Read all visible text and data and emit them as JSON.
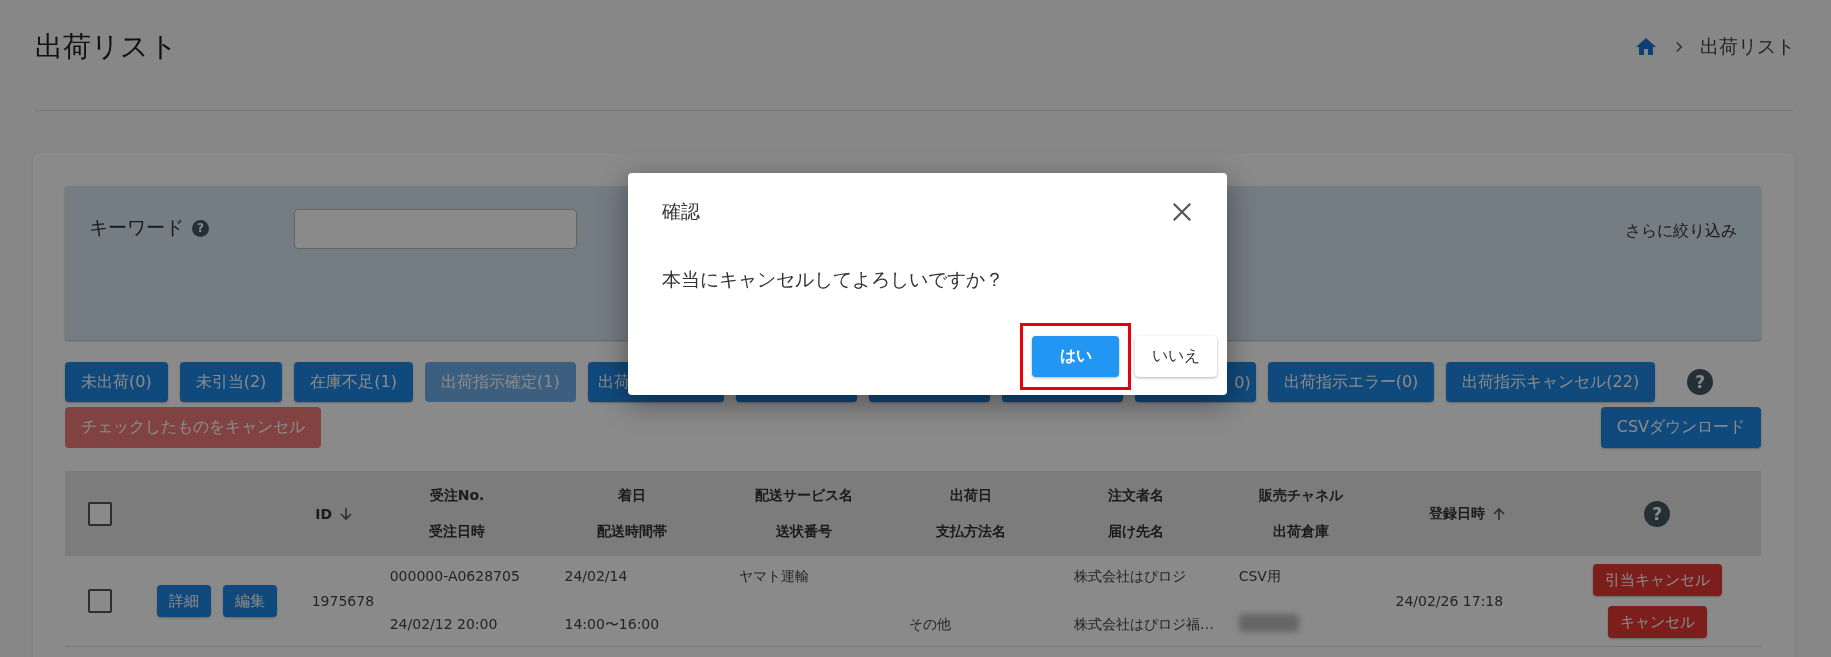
{
  "page": {
    "title": "出荷リスト"
  },
  "breadcrumb": {
    "current": "出荷リスト"
  },
  "filter": {
    "keyword_label": "キーワード",
    "help_icon": "?",
    "more_filters": "さらに絞り込み"
  },
  "status_help_icon": "?",
  "status_buttons": [
    {
      "label": "未出荷(0)",
      "disabled": false,
      "covered": false
    },
    {
      "label": "未引当(2)",
      "disabled": false,
      "covered": false
    },
    {
      "label": "在庫不足(1)",
      "disabled": false,
      "covered": false
    },
    {
      "label": "出荷指示確定(1)",
      "disabled": true,
      "covered": false
    },
    {
      "label": "出荷",
      "disabled": false,
      "covered": true,
      "shows_end": false
    },
    {
      "disabled": false,
      "covered": true
    },
    {
      "disabled": false,
      "covered": true
    },
    {
      "disabled": false,
      "covered": true
    },
    {
      "label": "0)",
      "disabled": false,
      "covered": true,
      "shows_end": true
    },
    {
      "label": "出荷指示エラー(0)",
      "disabled": false,
      "covered": false
    },
    {
      "label": "出荷指示キャンセル(22)",
      "disabled": false,
      "covered": false
    }
  ],
  "bulk_cancel": {
    "label": "チェックしたものをキャンセル",
    "disabled": true
  },
  "csv_button": {
    "label": "CSVダウンロード"
  },
  "table": {
    "columns": [
      {
        "kind": "checkbox",
        "checked": false
      },
      {
        "kind": "blank"
      },
      {
        "kind": "single",
        "label": "ID",
        "sort_descending": true
      },
      {
        "kind": "double",
        "top": "受注No.",
        "bottom": "受注日時"
      },
      {
        "kind": "double",
        "top": "着日",
        "bottom": "配送時間帯"
      },
      {
        "kind": "double",
        "top": "配送サービス名",
        "bottom": "送状番号"
      },
      {
        "kind": "double",
        "top": "出荷日",
        "bottom": "支払方法名"
      },
      {
        "kind": "double",
        "top": "注文者名",
        "bottom": "届け先名"
      },
      {
        "kind": "double",
        "top": "販売チャネル",
        "bottom": "出荷倉庫"
      },
      {
        "kind": "single",
        "label": "登録日時",
        "sort_descending": false
      },
      {
        "kind": "help",
        "label": "?"
      }
    ],
    "rows": [
      {
        "checked": false,
        "actions": [
          "詳細",
          "編集"
        ],
        "id": "1975678",
        "order_no": "000000-A0628705",
        "order_date": "24/02/12 20:00",
        "arrival_date": "24/02/14",
        "time_slot": "14:00〜16:00",
        "service": "ヤマト運輸",
        "payment": "その他",
        "orderer": "株式会社はぴロジ",
        "recipient": "株式会社はぴロジ福…",
        "channel": "CSV用",
        "warehouse_blurred": true,
        "registered": "24/02/26 17:18",
        "cancel_buttons": [
          "引当キャンセル",
          "キャンセル"
        ]
      }
    ]
  },
  "dialog": {
    "title": "確認",
    "message": "本当にキャンセルしてよろしいですか？",
    "buttons": [
      {
        "label": "はい",
        "kind": "primary",
        "highlighted": true
      },
      {
        "label": "いいえ",
        "kind": "secondary",
        "highlighted": false
      }
    ]
  }
}
